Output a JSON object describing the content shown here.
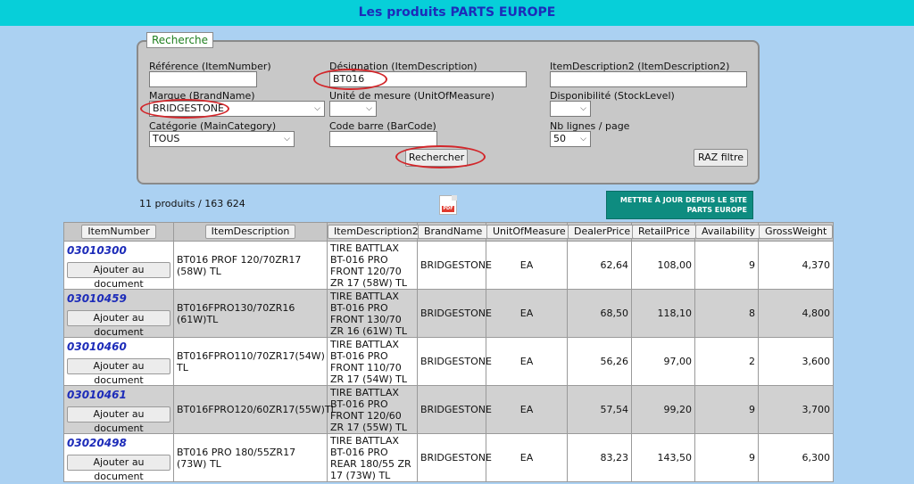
{
  "header": {
    "title": "Les produits PARTS EUROPE"
  },
  "search": {
    "legend": "Recherche",
    "reference_label": "Référence (ItemNumber)",
    "reference_value": "",
    "designation_label": "Désignation (ItemDescription)",
    "designation_value": "BT016",
    "desc2_label": "ItemDescription2 (ItemDescription2)",
    "desc2_value": "",
    "brand_label": "Marque (BrandName)",
    "brand_value": "BRIDGESTONE",
    "uom_label": "Unité de mesure (UnitOfMeasure)",
    "uom_value": "",
    "stock_label": "Disponibilité (StockLevel)",
    "stock_value": "",
    "category_label": "Catégorie (MainCategory)",
    "category_value": "TOUS",
    "barcode_label": "Code barre (BarCode)",
    "barcode_value": "",
    "lines_label": "Nb lignes / page",
    "lines_value": "50",
    "search_button": "Rechercher",
    "reset_button": "RAZ filtre"
  },
  "summary": {
    "count_text": "11 produits / 163 624"
  },
  "update_button": {
    "line1": "METTRE À JOUR DEPUIS LE SITE",
    "line2": "PARTS EUROPE"
  },
  "table": {
    "add_label": "Ajouter au document",
    "columns": [
      "ItemNumber",
      "ItemDescription",
      "ItemDescription2",
      "BrandName",
      "UnitOfMeasure",
      "DealerPrice",
      "RetailPrice",
      "Availability",
      "GrossWeight"
    ],
    "rows": [
      {
        "item": "03010300",
        "desc": "BT016 PROF 120/70ZR17 (58W) TL",
        "desc2": "TIRE BATTLAX BT-016 PRO FRONT 120/70 ZR 17 (58W) TL",
        "brand": "BRIDGESTONE",
        "uom": "EA",
        "dealer": "62,64",
        "retail": "108,00",
        "avail": "9",
        "weight": "4,370"
      },
      {
        "item": "03010459",
        "desc": "BT016FPRO130/70ZR16 (61W)TL",
        "desc2": "TIRE BATTLAX BT-016 PRO FRONT 130/70 ZR 16 (61W) TL",
        "brand": "BRIDGESTONE",
        "uom": "EA",
        "dealer": "68,50",
        "retail": "118,10",
        "avail": "8",
        "weight": "4,800"
      },
      {
        "item": "03010460",
        "desc": "BT016FPRO110/70ZR17(54W) TL",
        "desc2": "TIRE BATTLAX BT-016 PRO FRONT 110/70 ZR 17 (54W) TL",
        "brand": "BRIDGESTONE",
        "uom": "EA",
        "dealer": "56,26",
        "retail": "97,00",
        "avail": "2",
        "weight": "3,600"
      },
      {
        "item": "03010461",
        "desc": "BT016FPRO120/60ZR17(55W)TL",
        "desc2": "TIRE BATTLAX BT-016 PRO FRONT 120/60 ZR 17 (55W) TL",
        "brand": "BRIDGESTONE",
        "uom": "EA",
        "dealer": "57,54",
        "retail": "99,20",
        "avail": "9",
        "weight": "3,700"
      },
      {
        "item": "03020498",
        "desc": "BT016 PRO 180/55ZR17 (73W) TL",
        "desc2": "TIRE BATTLAX BT-016 PRO REAR 180/55 ZR 17 (73W) TL",
        "brand": "BRIDGESTONE",
        "uom": "EA",
        "dealer": "83,23",
        "retail": "143,50",
        "avail": "9",
        "weight": "6,300"
      }
    ]
  },
  "colors": {
    "topbar": "#07cfd9",
    "title": "#1d2cb9",
    "background": "#abd1f2",
    "highlight_ring": "#d2262a",
    "update_button": "#0e8c80"
  }
}
